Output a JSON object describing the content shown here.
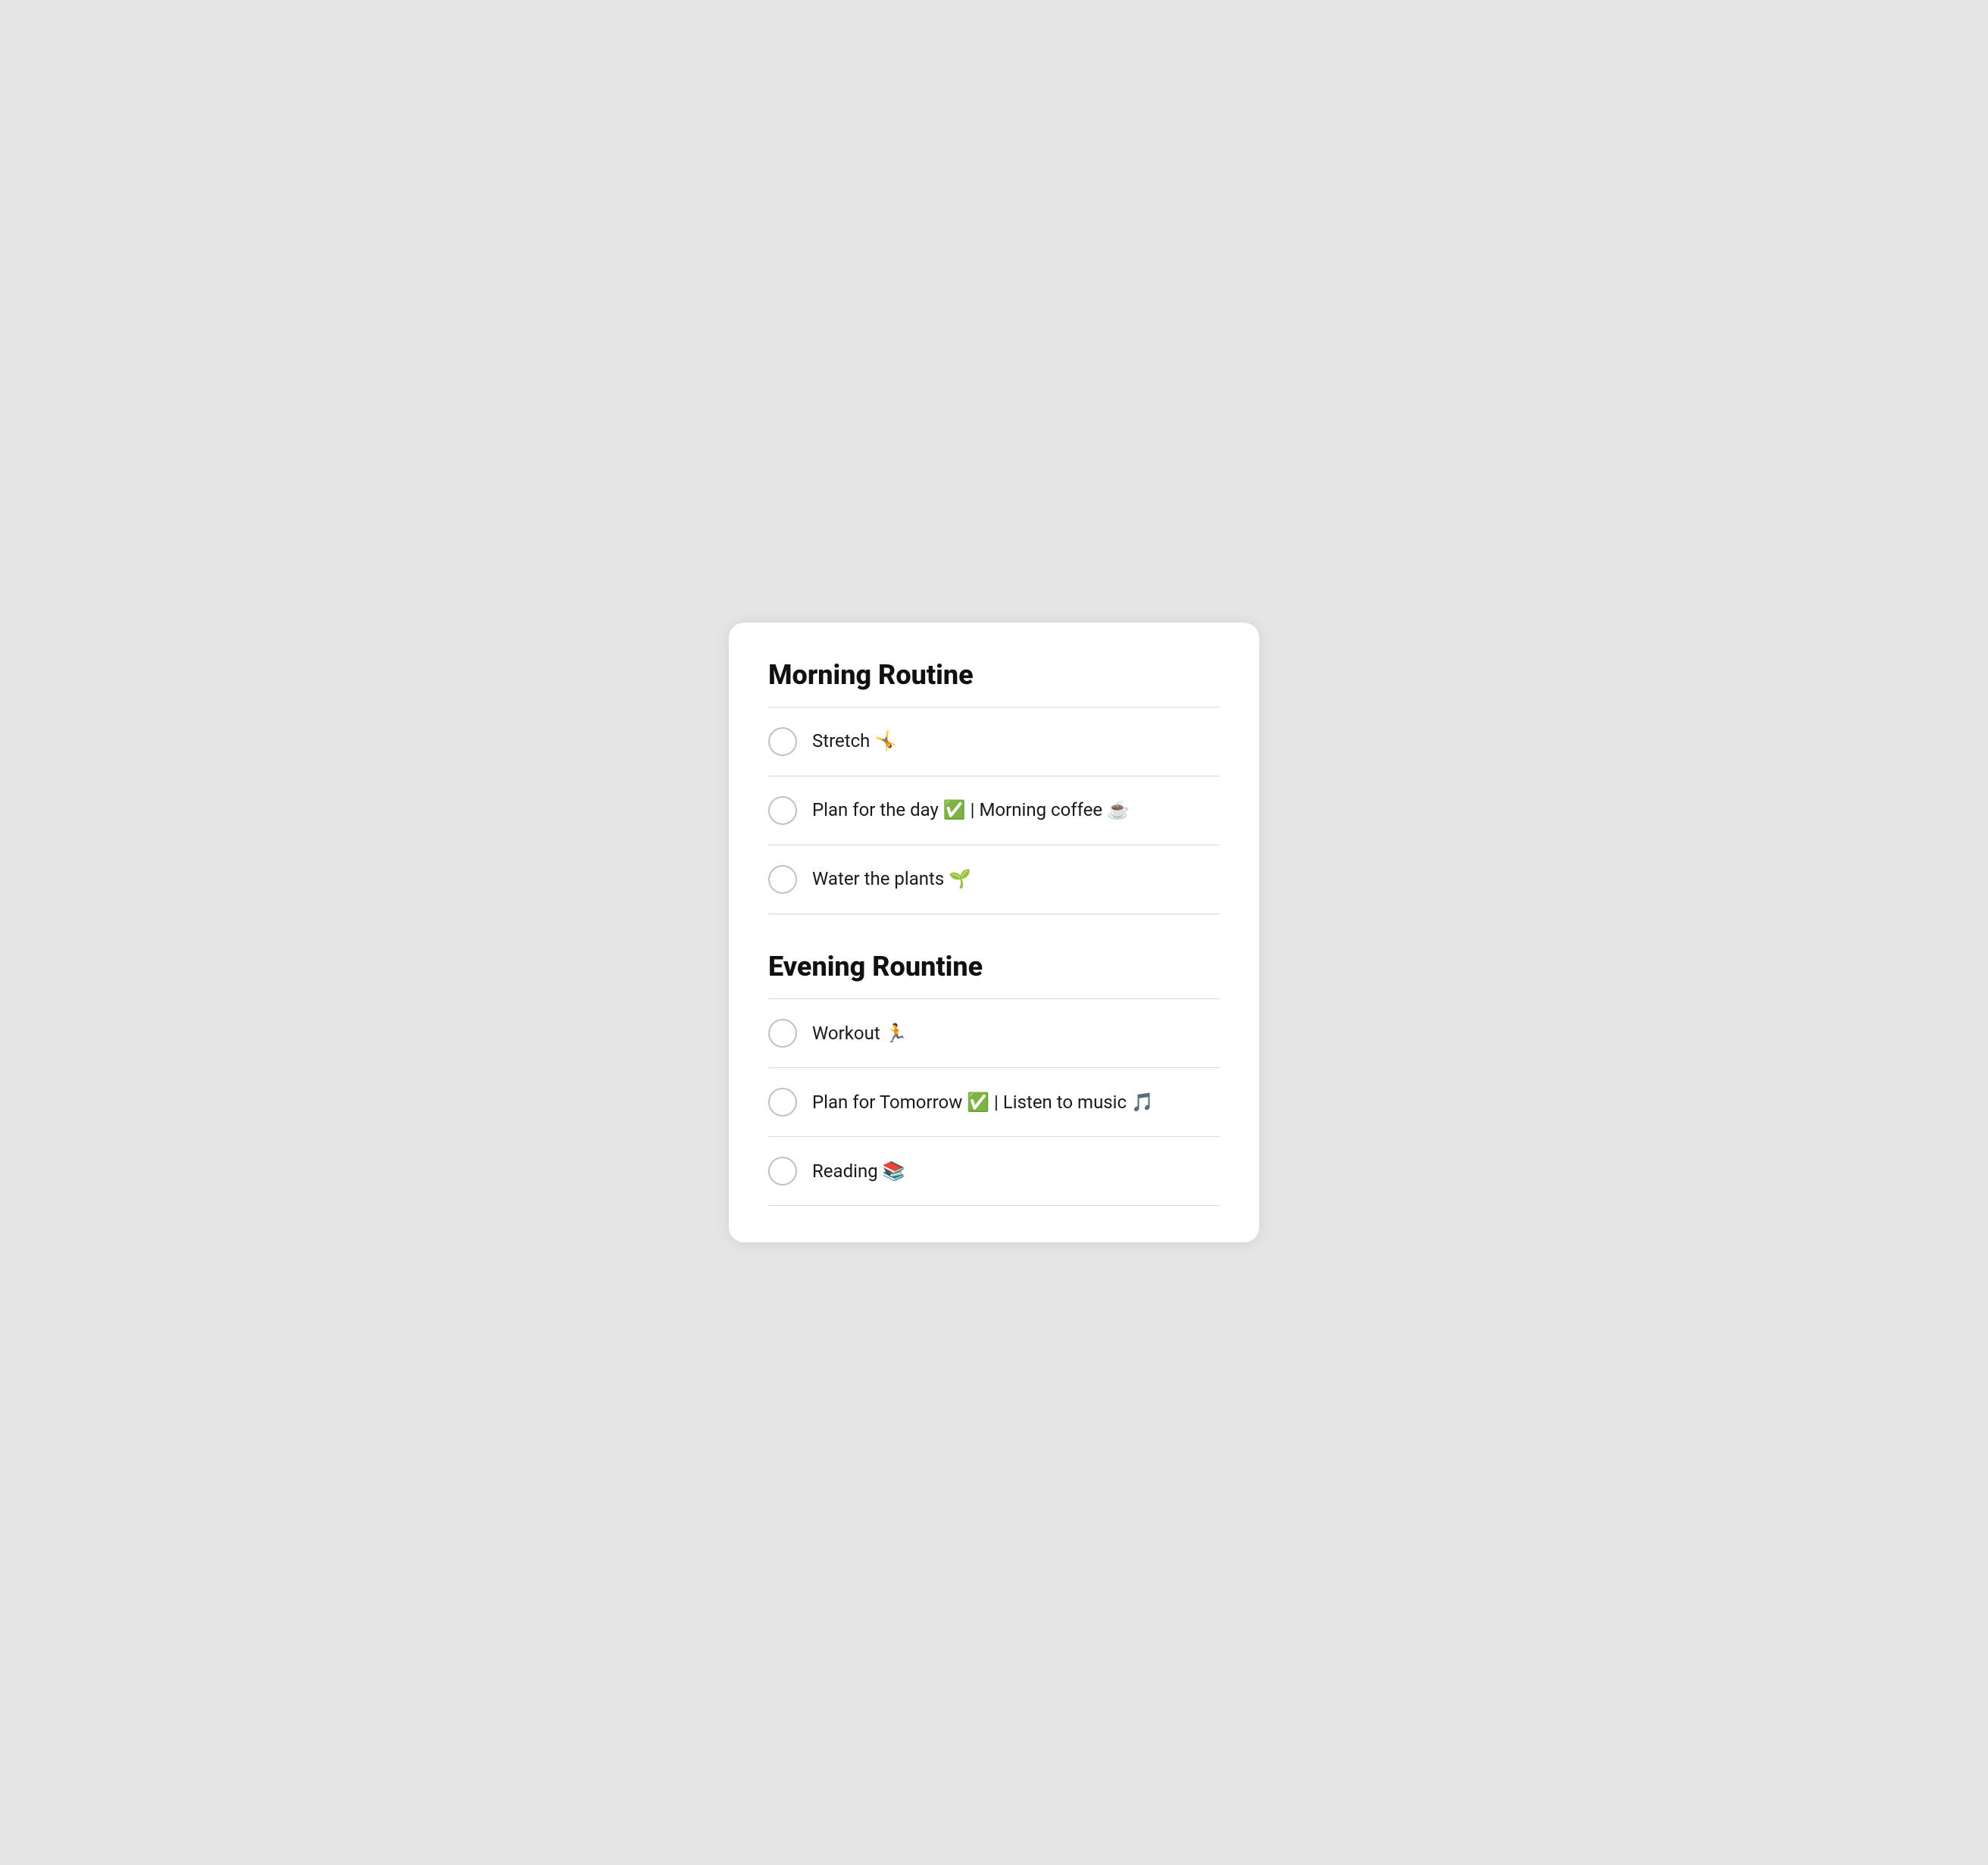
{
  "morning": {
    "title": "Morning Routine",
    "items": [
      {
        "id": "stretch",
        "label": "Stretch 🤸"
      },
      {
        "id": "plan-day",
        "label": "Plan for the day ✅ | Morning coffee ☕"
      },
      {
        "id": "water-plants",
        "label": "Water the plants 🌱"
      }
    ]
  },
  "evening": {
    "title": "Evening Rountine",
    "items": [
      {
        "id": "workout",
        "label": "Workout 🏃"
      },
      {
        "id": "plan-tomorrow",
        "label": "Plan for Tomorrow ✅ | Listen to music 🎵"
      },
      {
        "id": "reading",
        "label": "Reading 📚"
      }
    ]
  }
}
